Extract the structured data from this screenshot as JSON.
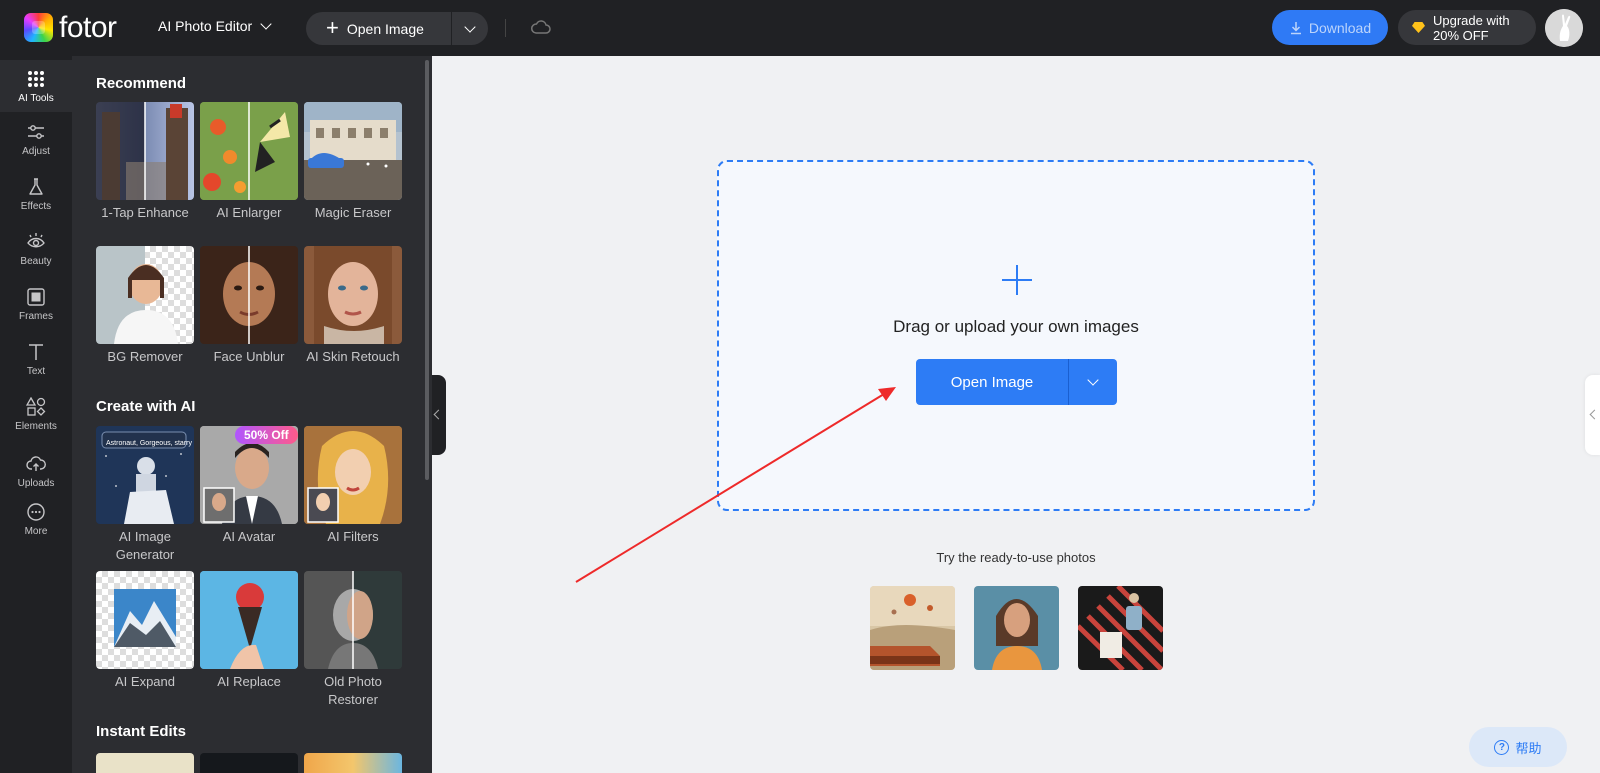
{
  "header": {
    "logo_text": "fotor",
    "editor_mode": "AI Photo Editor",
    "open_image_label": "Open Image",
    "download_label": "Download",
    "upgrade_line1": "Upgrade with",
    "upgrade_line2": "20% OFF"
  },
  "sidebar": {
    "items": [
      {
        "label": "AI Tools",
        "icon": "grid-dots-icon"
      },
      {
        "label": "Adjust",
        "icon": "sliders-icon"
      },
      {
        "label": "Effects",
        "icon": "flask-icon"
      },
      {
        "label": "Beauty",
        "icon": "eye-icon"
      },
      {
        "label": "Frames",
        "icon": "frame-icon"
      },
      {
        "label": "Text",
        "icon": "text-icon"
      },
      {
        "label": "Elements",
        "icon": "shapes-icon"
      },
      {
        "label": "Uploads",
        "icon": "cloud-upload-icon"
      },
      {
        "label": "More",
        "icon": "more-icon"
      }
    ]
  },
  "panel": {
    "sections": [
      {
        "title": "Recommend"
      },
      {
        "title": "Create with AI"
      },
      {
        "title": "Instant Edits"
      }
    ],
    "tools": [
      {
        "label": "1-Tap Enhance"
      },
      {
        "label": "AI Enlarger"
      },
      {
        "label": "Magic Eraser"
      },
      {
        "label": "BG Remover"
      },
      {
        "label": "Face Unblur"
      },
      {
        "label": "AI Skin Retouch"
      },
      {
        "label": "AI Image Generator",
        "prompt_text": "Astronaut, Gorgeous, starry"
      },
      {
        "label": "AI Avatar"
      },
      {
        "label": "AI Filters"
      },
      {
        "label": "AI Expand"
      },
      {
        "label": "AI Replace"
      },
      {
        "label": "Old Photo Restorer"
      }
    ],
    "badge": "50% Off"
  },
  "canvas": {
    "drop_text": "Drag or upload your own images",
    "open_button": "Open Image",
    "try_text": "Try the ready-to-use photos",
    "help_label": "帮助"
  },
  "colors": {
    "accent": "#2d7cf5",
    "annotation_arrow": "#ee2a2a"
  }
}
